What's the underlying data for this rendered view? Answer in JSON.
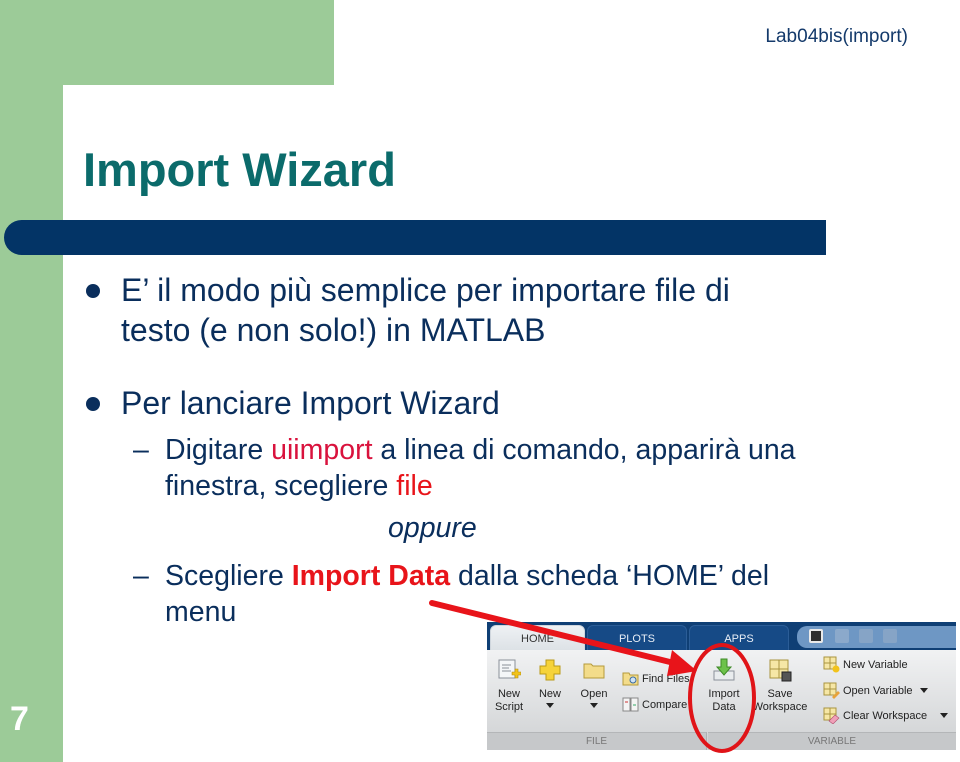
{
  "slide": {
    "header_tag": "Lab04bis(import)",
    "title": "Import Wizard",
    "slide_number": "7",
    "bullets": [
      {
        "line1": "E’ il modo più semplice per importare file di",
        "line2": "testo (e non solo!) in MATLAB"
      },
      {
        "line1": "Per lanciare Import Wizard"
      }
    ],
    "sub1": {
      "dash": "–",
      "pre": "Digitare ",
      "highlight": "uiimport",
      "post": " a linea di comando, apparirà una",
      "line2_pre": "finestra, scegliere ",
      "line2_highlight": "file"
    },
    "oppure": "oppure",
    "sub2": {
      "dash": "–",
      "pre": "Scegliere ",
      "highlight": "Import Data",
      "post": " dalla scheda ‘HOME’ del",
      "line2": "menu"
    },
    "colors": {
      "green": "#9ccb98",
      "title_teal": "#0b6b6b",
      "navy": "#033466",
      "text": "#0a2e5c",
      "highlight_red": "#e8141a",
      "highlight_pink_red": "#d9123d"
    }
  },
  "ribbon": {
    "tabs": [
      {
        "label": "HOME",
        "active": true
      },
      {
        "label": "PLOTS",
        "active": false
      },
      {
        "label": "APPS",
        "active": false
      }
    ],
    "file_group": {
      "label": "FILE",
      "new_script": [
        "New",
        "Script"
      ],
      "new": "New",
      "open": "Open",
      "find_files": "Find Files",
      "compare": "Compare"
    },
    "variable_group": {
      "label": "VARIABLE",
      "import_data": [
        "Import",
        "Data"
      ],
      "save_workspace": [
        "Save",
        "Workspace"
      ],
      "new_variable": "New Variable",
      "open_variable": "Open Variable",
      "clear_workspace": "Clear Workspace"
    }
  }
}
